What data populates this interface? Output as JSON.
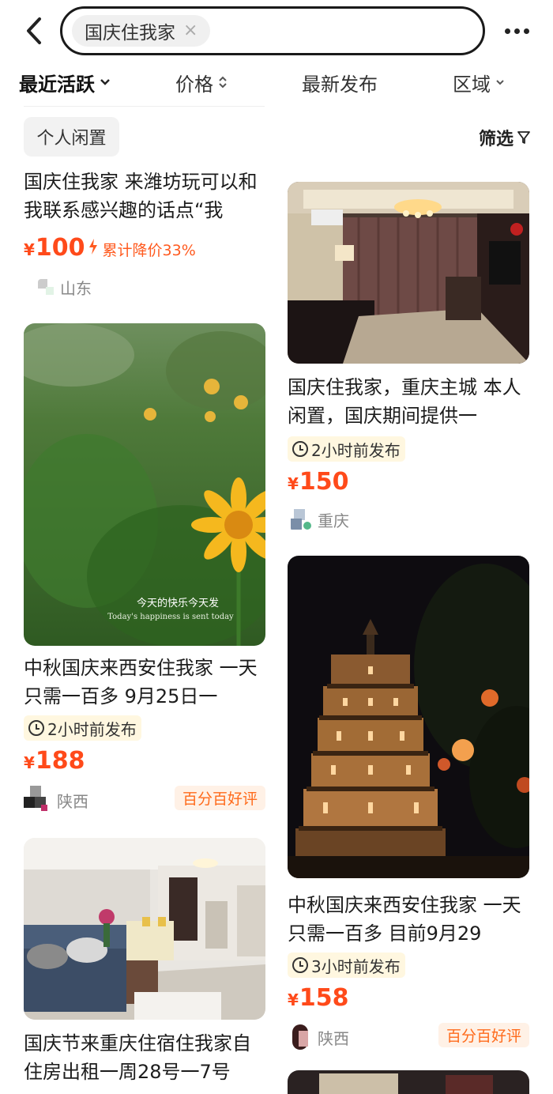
{
  "search": {
    "query": "国庆住我家",
    "clear": "×"
  },
  "filters": [
    {
      "label": "最近活跃",
      "arrow": "⌄"
    },
    {
      "label": "价格",
      "arrow": "⌃⌄"
    },
    {
      "label": "最新发布",
      "arrow": ""
    },
    {
      "label": "区域",
      "arrow": "⌄"
    }
  ],
  "side_tags": {
    "personal": "个人闲置",
    "filter": "筛选"
  },
  "cards": [
    {
      "title": "国庆住我家 来潍坊玩可以和我联系感兴趣的话点“我",
      "time": "",
      "price_symbol": "¥",
      "price": "100",
      "price_cut": "累计降价33%",
      "region": "山东",
      "badge": ""
    },
    {
      "title": "国庆住我家，重庆主城 本人闲置，国庆期间提供一",
      "time": "2小时前发布",
      "price_symbol": "¥",
      "price": "150",
      "price_cut": "",
      "region": "重庆",
      "badge": ""
    },
    {
      "title": "中秋国庆来西安住我家 一天只需一百多 9月25日一",
      "time": "2小时前发布",
      "price_symbol": "¥",
      "price": "188",
      "price_cut": "",
      "region": "陕西",
      "badge": "百分百好评",
      "image_caption_cn": "今天的快乐今天发",
      "image_caption_en": "Today's happiness is sent today"
    },
    {
      "title": "中秋国庆来西安住我家 一天只需一百多 目前9月29",
      "time": "3小时前发布",
      "price_symbol": "¥",
      "price": "158",
      "price_cut": "",
      "region": "陕西",
      "badge": "百分百好评"
    },
    {
      "title": "国庆节来重庆住宿住我家自住房出租一周28号一7号",
      "time": "",
      "price_symbol": "",
      "price": "",
      "price_cut": "",
      "region": "",
      "badge": ""
    }
  ],
  "colors": {
    "price": "#ff4a1a",
    "badge_bg": "#fff1e6",
    "time_bg": "#fff7e0"
  }
}
